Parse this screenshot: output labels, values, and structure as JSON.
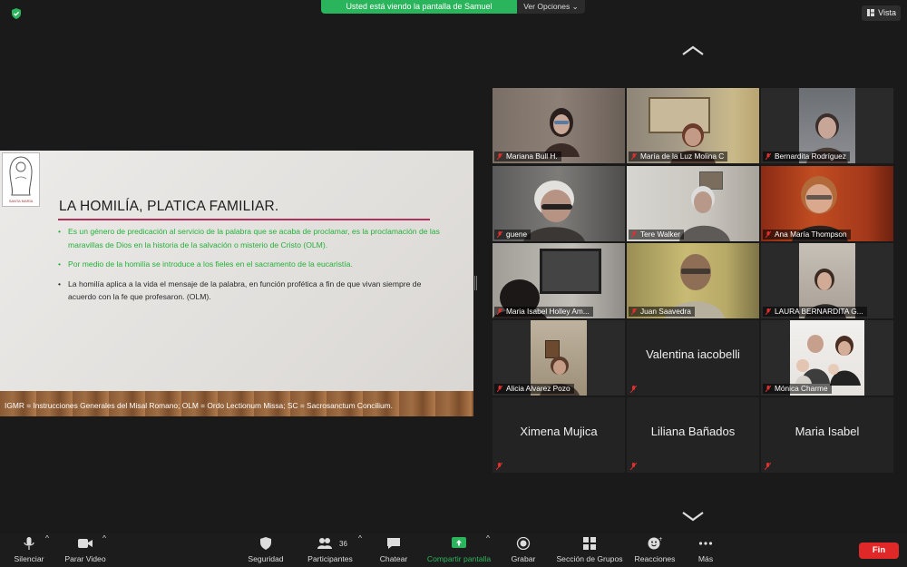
{
  "top_bar": {
    "share_banner": "Usted está viendo la pantalla de Samuel",
    "view_options": "Ver Opciones",
    "vista": "Vista"
  },
  "slide": {
    "logo_text": "SANTA MARÍA",
    "title": "LA HOMILÍA, PLATICA FAMILIAR.",
    "bullets": [
      {
        "text": "Es un género de predicación  al servicio de la palabra que se acaba de proclamar, es la proclamación de las maravillas de Dios en la historia de la salvación o misterio de Cristo (OLM).",
        "color": "#25b13a"
      },
      {
        "text": "Por medio de la homilía  se introduce a los fieles en el sacramento de la eucaristía.",
        "color": "#25b13a"
      },
      {
        "text": "La homilía aplica a la vida el mensaje de la palabra, en función profética a fin de que vivan siempre de acuerdo con la fe que profesaron. (OLM).",
        "color": "#2a2a2a"
      }
    ],
    "footer": "IGMR = Instrucciones Generales del Misal Romano;  OLM = Ordo Lectionum Missa;  SC = Sacrosanctum Concilium."
  },
  "participants": [
    {
      "name": "Mariana Bull H.",
      "video": true
    },
    {
      "name": "María de la Luz Molina C",
      "video": true
    },
    {
      "name": "Bernardita Rodríguez",
      "video": true
    },
    {
      "name": "guene",
      "video": true
    },
    {
      "name": "Tere Walker",
      "video": true
    },
    {
      "name": "Ana María Thompson",
      "video": true
    },
    {
      "name": "Maria Isabel Holley Am...",
      "video": true
    },
    {
      "name": "Juan Saavedra",
      "video": true
    },
    {
      "name": "LAURA BERNARDITA G...",
      "video": true
    },
    {
      "name": "Alicia Alvarez Pozo",
      "video": true
    },
    {
      "name": "Valentina iacobelli",
      "video": false
    },
    {
      "name": "Mónica Charme",
      "video": true
    },
    {
      "name": "Ximena Mujica",
      "video": false
    },
    {
      "name": "Liliana Bañados",
      "video": false
    },
    {
      "name": "Maria Isabel",
      "video": false
    }
  ],
  "toolbar": {
    "mute": "Silenciar",
    "stop_video": "Parar Video",
    "security": "Seguridad",
    "participants": "Participantes",
    "participants_count": "36",
    "chat": "Chatear",
    "share_screen": "Compartir pantalla",
    "record": "Grabar",
    "breakout": "Sección de Grupos",
    "reactions": "Reacciones",
    "more": "Más",
    "end": "Fin"
  },
  "colors": {
    "banner_green": "#2ab45c",
    "share_green": "#2ab45c",
    "end_red": "#e02828",
    "muted_red": "#e0302f"
  }
}
